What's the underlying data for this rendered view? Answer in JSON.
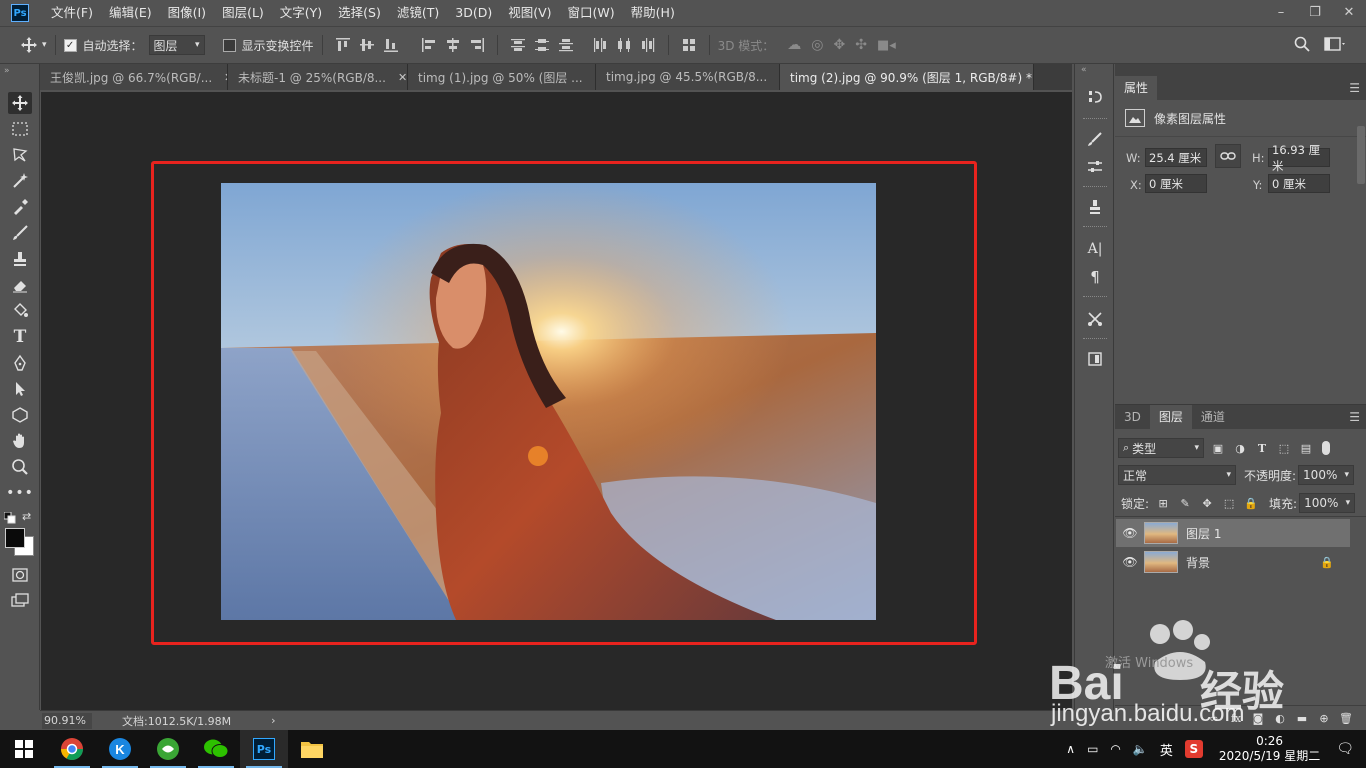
{
  "menubar": {
    "app_badge": "Ps",
    "items": [
      "文件(F)",
      "编辑(E)",
      "图像(I)",
      "图层(L)",
      "文字(Y)",
      "选择(S)",
      "滤镜(T)",
      "3D(D)",
      "视图(V)",
      "窗口(W)",
      "帮助(H)"
    ],
    "window_controls": [
      "–",
      "❐",
      "✕"
    ]
  },
  "options": {
    "auto_select_label": "自动选择：",
    "auto_select_checked": true,
    "layer_select_value": "图层",
    "transform_controls_label": "显示变换控件",
    "mode_3d_label": "3D 模式："
  },
  "tabs": [
    {
      "label": "王俊凯.jpg @ 66.7%(RGB/...",
      "close": "✕",
      "active": false
    },
    {
      "label": "未标题-1 @ 25%(RGB/8...",
      "close": "✕",
      "active": false
    },
    {
      "label": "timg (1).jpg @ 50% (图层 ...",
      "close": "✕",
      "active": false
    },
    {
      "label": "timg.jpg @ 45.5%(RGB/8...",
      "close": "✕",
      "active": false
    },
    {
      "label": "timg (2).jpg @ 90.9% (图层 1, RGB/8#) *",
      "close": "✕",
      "active": true
    }
  ],
  "status": {
    "zoom": "90.91%",
    "doc_info": "文档:1012.5K/1.98M",
    "arrow": "›"
  },
  "properties": {
    "tab_label": "属性",
    "section_title": "像素图层属性",
    "w_label": "W:",
    "w_value": "25.4 厘米",
    "h_label": "H:",
    "h_value": "16.93 厘米",
    "x_label": "X:",
    "x_value": "0 厘米",
    "y_label": "Y:",
    "y_value": "0 厘米"
  },
  "layers_panel": {
    "tabs": [
      "3D",
      "图层",
      "通道"
    ],
    "active_tab": "图层",
    "filter_kind": "类型",
    "blend_mode": "正常",
    "opacity_label": "不透明度:",
    "opacity_value": "100%",
    "lock_label": "锁定:",
    "fill_label": "填充:",
    "fill_value": "100%",
    "layers": [
      {
        "name": "图层 1",
        "selected": true,
        "locked": false
      },
      {
        "name": "背景",
        "selected": false,
        "locked": true
      }
    ]
  },
  "taskbar": {
    "ime": "英",
    "time": "0:26",
    "date": "2020/5/19 星期二"
  },
  "watermark": {
    "text": "jingyan.baidu.com",
    "windows_text": "激活 Windows",
    "brand": "Bai",
    "brand_cn": "经验"
  },
  "colors": {
    "accent_red": "#e8231e",
    "panel_bg": "#535353",
    "canvas_bg": "#282828"
  }
}
